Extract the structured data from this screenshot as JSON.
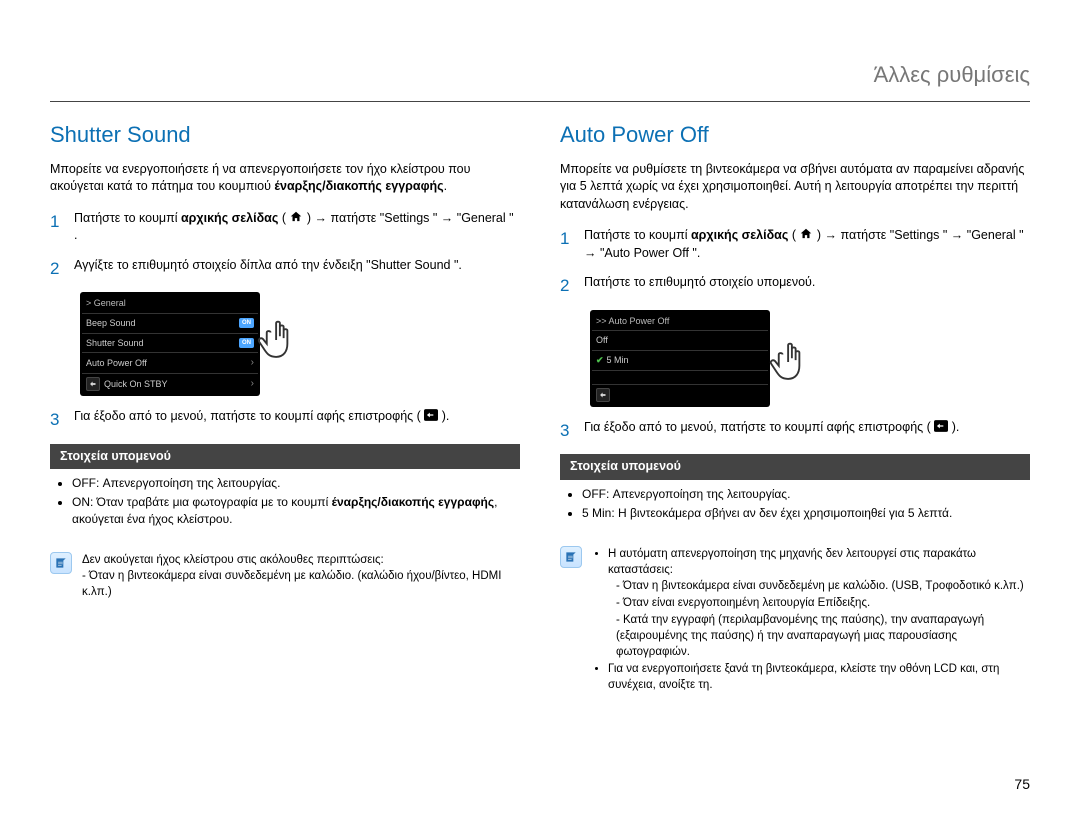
{
  "header": "Άλλες ρυθμίσεις",
  "page_number": "75",
  "left": {
    "title": "Shutter Sound",
    "intro_pre": "Μπορείτε να ενεργοποιήσετε ή να απενεργοποιήσετε τον ήχο κλείστρου που ακούγεται κατά το πάτημα του κουμπιού ",
    "intro_bold": "έναρξης/διακοπής εγγραφής",
    "intro_post": ".",
    "step1_pre": "Πατήστε το κουμπί ",
    "step1_bold": "αρχικής σελίδας",
    "step1_mid1": " ( ",
    "step1_mid2": " ) → πατήστε \"Settings \" → \"General \" .",
    "step2": "Αγγίξτε το επιθυμητό στοιχείο δίπλα από την ένδειξη \"Shutter Sound \".",
    "step3_a": "Για έξοδο από το μενού, πατήστε το κουμπί αφής επιστροφής ( ",
    "step3_b": " ).",
    "ui": {
      "header": "> General",
      "row1": "Beep Sound",
      "row1_toggle": "ON",
      "row2": "Shutter Sound",
      "row2_toggle": "ON",
      "row3": "Auto Power Off",
      "row4": "Quick On STBY"
    },
    "submenu_title": "Στοιχεία υπομενού",
    "sub_off": "OFF: Απενεργοποίηση της λειτουργίας.",
    "sub_on_pre": "ON: Όταν τραβάτε μια φωτογραφία με το κουμπί ",
    "sub_on_bold": "έναρξης/διακοπής εγγραφής",
    "sub_on_post": ", ακούγεται ένα ήχος κλείστρου.",
    "note_intro": "Δεν ακούγεται ήχος κλείστρου στις ακόλουθες περιπτώσεις:",
    "note_item": "- Όταν η βιντεοκάμερα είναι συνδεδεμένη με καλώδιο. (καλώδιο ήχου/βίντεο, HDMI κ.λπ.)"
  },
  "right": {
    "title": "Auto Power Off",
    "intro": "Μπορείτε να ρυθμίσετε τη βιντεοκάμερα να σβήνει αυτόματα αν παραμείνει αδρανής για 5 λεπτά χωρίς να έχει χρησιμοποιηθεί. Αυτή η λειτουργία αποτρέπει την περιττή κατανάλωση ενέργειας.",
    "step1_pre": "Πατήστε το κουμπί ",
    "step1_bold": "αρχικής σελίδας",
    "step1_mid1": " ( ",
    "step1_mid2": " ) → πατήστε \"Settings \" → \"General \" → \"Auto Power Off \".",
    "step2": "Πατήστε το επιθυμητό στοιχείο υπομενού.",
    "step3_a": "Για έξοδο από το μενού, πατήστε το κουμπί αφής επιστροφής ( ",
    "step3_b": " ).",
    "ui": {
      "header": ">> Auto Power Off",
      "row1": "Off",
      "row2": "5 Min"
    },
    "submenu_title": "Στοιχεία υπομενού",
    "sub_off": "OFF: Απενεργοποίηση της λειτουργίας.",
    "sub_5min": "5 Min: Η βιντεοκάμερα σβήνει αν δεν έχει χρησιμοποιηθεί για 5 λεπτά.",
    "note_intro": "Η αυτόματη απενεργοποίηση της μηχανής δεν λειτουργεί στις παρακάτω καταστάσεις:",
    "note_items": [
      "- Όταν η βιντεοκάμερα είναι συνδεδεμένη με καλώδιο. (USB, Τροφοδοτικό κ.λπ.)",
      "- Όταν είναι ενεργοποιημένη λειτουργία Επίδειξης.",
      "- Κατά την εγγραφή (περιλαμβανομένης της παύσης), την αναπαραγωγή (εξαιρουμένης της παύσης) ή την αναπαραγωγή μιας παρουσίασης φωτογραφιών."
    ],
    "note_extra": "Για να ενεργοποιήσετε ξανά τη βιντεοκάμερα, κλείστε την οθόνη LCD και, στη συνέχεια, ανοίξτε τη."
  }
}
